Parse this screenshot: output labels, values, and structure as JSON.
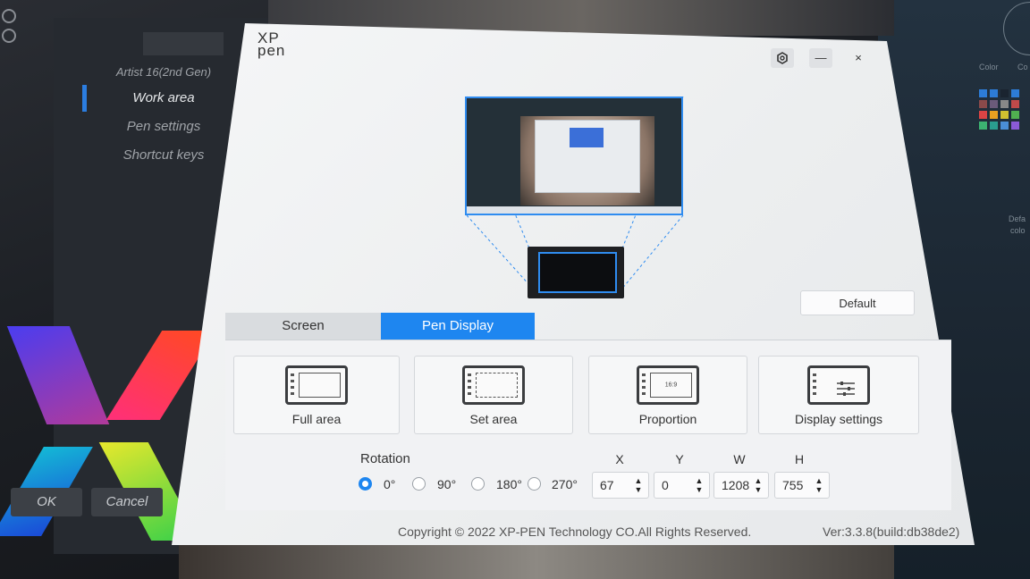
{
  "sidebar": {
    "device": "Artist 16(2nd Gen)",
    "items": [
      {
        "label": "Work area",
        "active": true
      },
      {
        "label": "Pen settings",
        "active": false
      },
      {
        "label": "Shortcut keys",
        "active": false
      }
    ],
    "ok_label": "OK",
    "cancel_label": "Cancel"
  },
  "right_panel": {
    "label_color": "Color",
    "label_co": "Co",
    "label_defa": "Defa",
    "label_colo": "colo"
  },
  "window": {
    "logo_top": "XP",
    "logo_bottom": "pen",
    "settings_icon": "gear-icon",
    "minimize_label": "—",
    "close_label": "×"
  },
  "work_area": {
    "default_label": "Default",
    "tabs": [
      {
        "label": "Screen",
        "active": false
      },
      {
        "label": "Pen Display",
        "active": true
      }
    ],
    "modes": [
      {
        "label": "Full area",
        "icon": "full-area-icon"
      },
      {
        "label": "Set area",
        "icon": "set-area-icon"
      },
      {
        "label": "Proportion",
        "icon": "proportion-icon",
        "icon_text": "16:9"
      },
      {
        "label": "Display settings",
        "icon": "display-settings-icon"
      }
    ],
    "rotation": {
      "title": "Rotation",
      "options": [
        "0°",
        "90°",
        "180°",
        "270°"
      ],
      "selected": "0°"
    },
    "coords": {
      "x_label": "X",
      "x_value": "67",
      "y_label": "Y",
      "y_value": "0",
      "w_label": "W",
      "w_value": "1208",
      "h_label": "H",
      "h_value": "755"
    }
  },
  "footer": {
    "copyright": "Copyright © 2022  XP-PEN Technology CO.All Rights Reserved.",
    "version": "Ver:3.3.8(build:db38de2)"
  },
  "colors": {
    "accent": "#1e86f0",
    "window_bg": "#f1f2f4"
  }
}
